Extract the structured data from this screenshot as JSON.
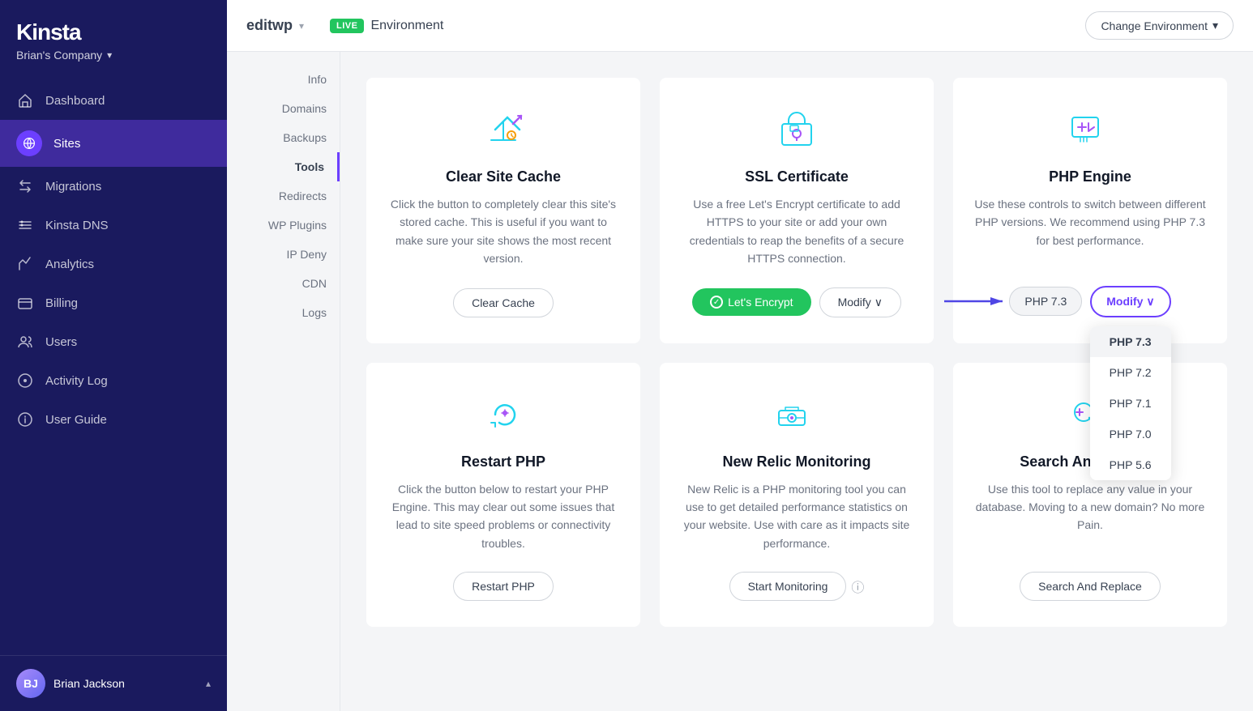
{
  "sidebar": {
    "logo": "Kinsta",
    "company": "Brian's Company",
    "nav_items": [
      {
        "id": "dashboard",
        "label": "Dashboard",
        "icon": "home-icon",
        "active": false
      },
      {
        "id": "sites",
        "label": "Sites",
        "icon": "sites-icon",
        "active": true
      },
      {
        "id": "migrations",
        "label": "Migrations",
        "icon": "migrations-icon",
        "active": false
      },
      {
        "id": "kinsta-dns",
        "label": "Kinsta DNS",
        "icon": "dns-icon",
        "active": false
      },
      {
        "id": "analytics",
        "label": "Analytics",
        "icon": "analytics-icon",
        "active": false
      },
      {
        "id": "billing",
        "label": "Billing",
        "icon": "billing-icon",
        "active": false
      },
      {
        "id": "users",
        "label": "Users",
        "icon": "users-icon",
        "active": false
      },
      {
        "id": "activity-log",
        "label": "Activity Log",
        "icon": "activity-icon",
        "active": false
      },
      {
        "id": "user-guide",
        "label": "User Guide",
        "icon": "guide-icon",
        "active": false
      }
    ],
    "user": {
      "name": "Brian Jackson",
      "avatar_initials": "BJ"
    }
  },
  "topbar": {
    "site_name": "editwp",
    "environment_badge": "LIVE",
    "environment_label": "Environment",
    "change_env_label": "Change Environment"
  },
  "sub_nav": {
    "items": [
      {
        "id": "info",
        "label": "Info",
        "active": false
      },
      {
        "id": "domains",
        "label": "Domains",
        "active": false
      },
      {
        "id": "backups",
        "label": "Backups",
        "active": false
      },
      {
        "id": "tools",
        "label": "Tools",
        "active": true
      },
      {
        "id": "redirects",
        "label": "Redirects",
        "active": false
      },
      {
        "id": "wp-plugins",
        "label": "WP Plugins",
        "active": false
      },
      {
        "id": "ip-deny",
        "label": "IP Deny",
        "active": false
      },
      {
        "id": "cdn",
        "label": "CDN",
        "active": false
      },
      {
        "id": "logs",
        "label": "Logs",
        "active": false
      }
    ]
  },
  "tools": {
    "cards": [
      {
        "id": "clear-cache",
        "title": "Clear Site Cache",
        "description": "Click the button to completely clear this site's stored cache. This is useful if you want to make sure your site shows the most recent version.",
        "button_label": "Clear Cache",
        "button_type": "default"
      },
      {
        "id": "ssl-certificate",
        "title": "SSL Certificate",
        "description": "Use a free Let's Encrypt certificate to add HTTPS to your site or add your own credentials to reap the benefits of a secure HTTPS connection.",
        "button_label": "Let's Encrypt",
        "button_type": "green",
        "secondary_button_label": "Modify"
      },
      {
        "id": "php-engine",
        "title": "PHP Engine",
        "description": "Use these controls to switch between different PHP versions. We recommend using PHP 7.3 for best performance.",
        "current_version": "PHP 7.3",
        "modify_label": "Modify",
        "dropdown_versions": [
          "PHP 7.3",
          "PHP 7.2",
          "PHP 7.1",
          "PHP 7.0",
          "PHP 5.6"
        ],
        "selected_version": "PHP 7.3"
      },
      {
        "id": "restart-php",
        "title": "Restart PHP",
        "description": "Click the button below to restart your PHP Engine. This may clear out some issues that lead to site speed problems or connectivity troubles.",
        "button_label": "Restart PHP",
        "button_type": "default"
      },
      {
        "id": "new-relic",
        "title": "New Relic Monitoring",
        "description": "New Relic is a PHP monitoring tool you can use to get detailed performance statistics on your website. Use with care as it impacts site performance.",
        "button_label": "Start Monitoring",
        "button_type": "default"
      },
      {
        "id": "search-replace",
        "title": "Search And Replace",
        "description": "Use this tool to replace any value in your database. Moving to a new domain? No more Pain.",
        "button_label": "Search And Replace",
        "button_type": "default"
      }
    ]
  }
}
